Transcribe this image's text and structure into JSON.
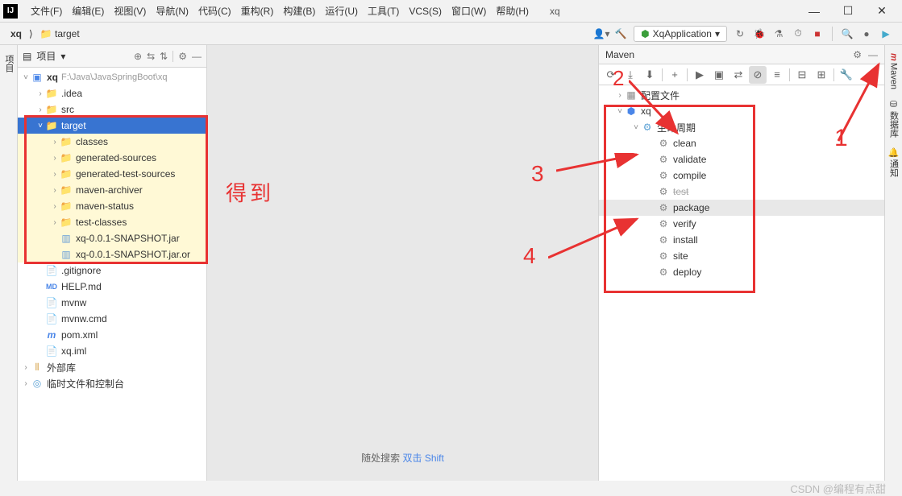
{
  "title": "xq",
  "menu": [
    "文件(F)",
    "编辑(E)",
    "视图(V)",
    "导航(N)",
    "代码(C)",
    "重构(R)",
    "构建(B)",
    "运行(U)",
    "工具(T)",
    "VCS(S)",
    "窗口(W)",
    "帮助(H)"
  ],
  "breadcrumb": {
    "root": "xq",
    "sep": "⟩",
    "folder": "target"
  },
  "run_config": "XqApplication",
  "project_panel": {
    "title": "项目",
    "root": {
      "name": "xq",
      "path": "F:\\Java\\JavaSpringBoot\\xq"
    },
    "items": [
      {
        "indent": 1,
        "arrow": ">",
        "icon": "folder",
        "name": ".idea"
      },
      {
        "indent": 1,
        "arrow": ">",
        "icon": "folder-blue",
        "name": "src"
      },
      {
        "indent": 1,
        "arrow": "v",
        "icon": "folder",
        "name": "target",
        "selected": true
      },
      {
        "indent": 2,
        "arrow": ">",
        "icon": "folder",
        "name": "classes",
        "hl": true
      },
      {
        "indent": 2,
        "arrow": ">",
        "icon": "folder",
        "name": "generated-sources",
        "hl": true
      },
      {
        "indent": 2,
        "arrow": ">",
        "icon": "folder",
        "name": "generated-test-sources",
        "hl": true
      },
      {
        "indent": 2,
        "arrow": ">",
        "icon": "folder",
        "name": "maven-archiver",
        "hl": true
      },
      {
        "indent": 2,
        "arrow": ">",
        "icon": "folder",
        "name": "maven-status",
        "hl": true
      },
      {
        "indent": 2,
        "arrow": ">",
        "icon": "folder",
        "name": "test-classes",
        "hl": true
      },
      {
        "indent": 2,
        "arrow": "",
        "icon": "jar",
        "name": "xq-0.0.1-SNAPSHOT.jar",
        "hl": true
      },
      {
        "indent": 2,
        "arrow": "",
        "icon": "jar",
        "name": "xq-0.0.1-SNAPSHOT.jar.or",
        "hl": true
      },
      {
        "indent": 1,
        "arrow": "",
        "icon": "file",
        "name": ".gitignore"
      },
      {
        "indent": 1,
        "arrow": "",
        "icon": "md",
        "name": "HELP.md"
      },
      {
        "indent": 1,
        "arrow": "",
        "icon": "file",
        "name": "mvnw"
      },
      {
        "indent": 1,
        "arrow": "",
        "icon": "file",
        "name": "mvnw.cmd"
      },
      {
        "indent": 1,
        "arrow": "",
        "icon": "maven",
        "name": "pom.xml"
      },
      {
        "indent": 1,
        "arrow": "",
        "icon": "file",
        "name": "xq.iml"
      }
    ],
    "external": "外部库",
    "scratch": "临时文件和控制台"
  },
  "search_hint": {
    "prefix": "随处搜索 ",
    "action": "双击 Shift"
  },
  "maven": {
    "title": "Maven",
    "profiles": "配置文件",
    "project": "xq",
    "lifecycle": "生命周期",
    "goals": [
      "clean",
      "validate",
      "compile",
      "test",
      "package",
      "verify",
      "install",
      "site",
      "deploy"
    ]
  },
  "right_tabs": [
    "Maven",
    "数据库",
    "通知"
  ],
  "left_tabs": [
    "项目"
  ],
  "annotations": {
    "got": "得到",
    "n1": "1",
    "n2": "2",
    "n3": "3",
    "n4": "4"
  },
  "footer": "CSDN @编程有点甜"
}
